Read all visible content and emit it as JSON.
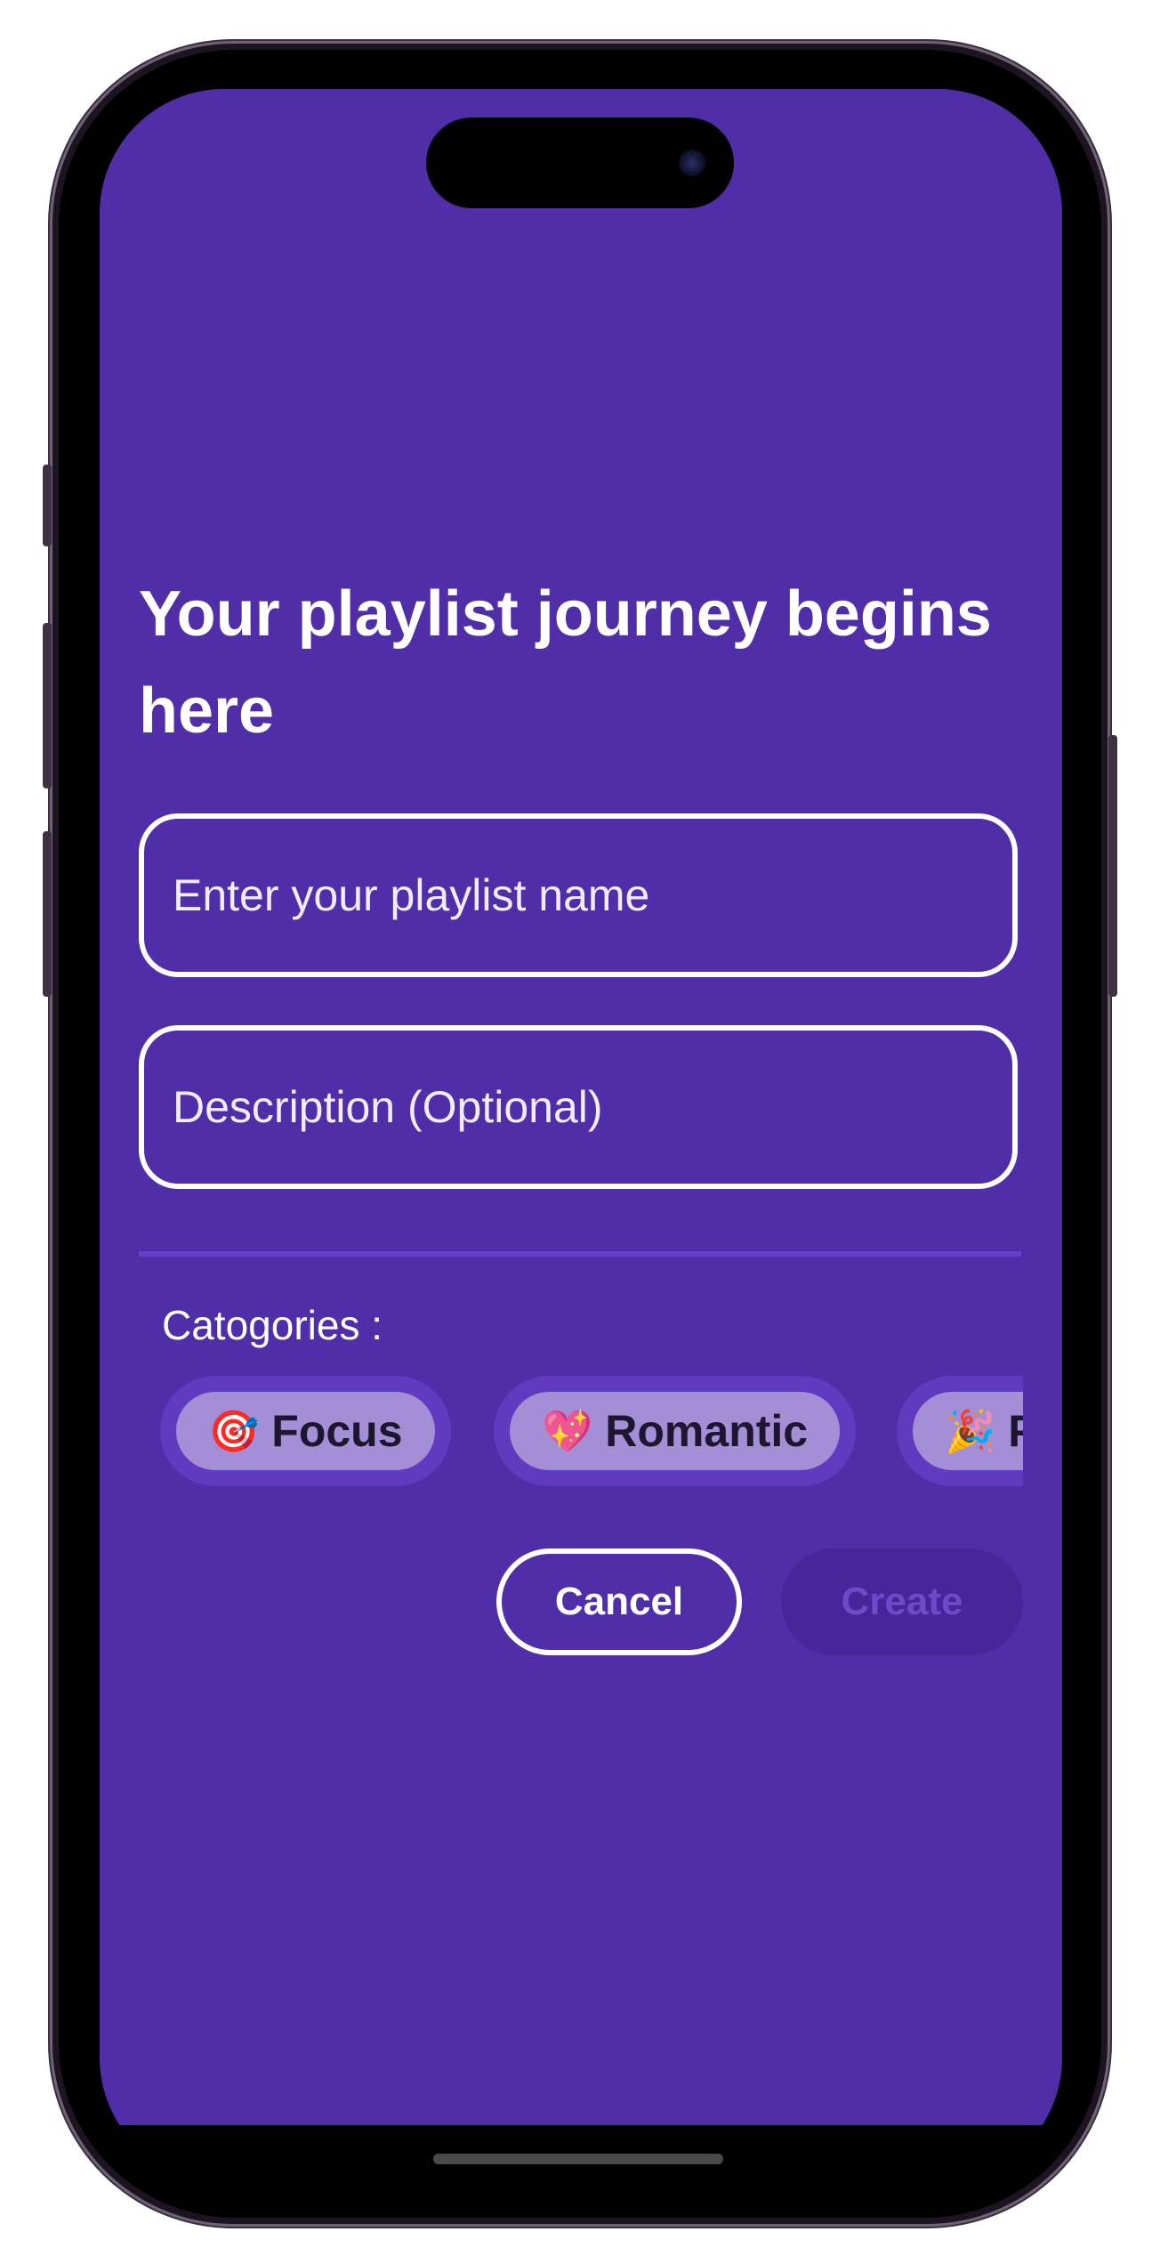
{
  "page": {
    "title": "Your playlist journey begins here"
  },
  "form": {
    "name_placeholder": "Enter your playlist name",
    "description_placeholder": "Description (Optional)"
  },
  "categories": {
    "label": "Catogories :",
    "items": [
      {
        "emoji": "🎯",
        "label": "Focus",
        "icon": "direct-hit-icon"
      },
      {
        "emoji": "💖",
        "label": "Romantic",
        "icon": "sparkling-heart-icon"
      },
      {
        "emoji": "🎉",
        "label": "Party",
        "icon": "party-popper-icon"
      }
    ]
  },
  "actions": {
    "cancel_label": "Cancel",
    "create_label": "Create"
  },
  "colors": {
    "background": "#502ea8",
    "chip_fill": "#a48ed6",
    "create_disabled": "#45279a"
  }
}
